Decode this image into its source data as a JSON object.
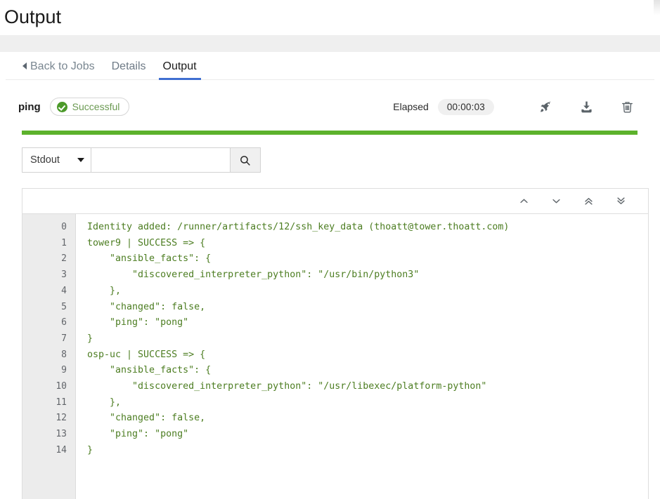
{
  "page": {
    "title": "Output"
  },
  "tabs": [
    {
      "label": "Back to Jobs",
      "name": "tab-back-to-jobs",
      "active": false
    },
    {
      "label": "Details",
      "name": "tab-details",
      "active": false
    },
    {
      "label": "Output",
      "name": "tab-output",
      "active": true
    }
  ],
  "job": {
    "name": "ping",
    "status_label": "Successful",
    "status_color": "#4c9a2a",
    "elapsed_label": "Elapsed",
    "elapsed_value": "00:00:03",
    "progress_color": "#5cb22c",
    "actions": [
      {
        "name": "relaunch-icon",
        "title": "Relaunch"
      },
      {
        "name": "download-icon",
        "title": "Download Output"
      },
      {
        "name": "delete-icon",
        "title": "Delete Job"
      }
    ]
  },
  "search": {
    "select_value": "Stdout",
    "input_value": "",
    "placeholder": "",
    "button_icon": "search-icon"
  },
  "output_nav": [
    {
      "name": "scroll-up-icon"
    },
    {
      "name": "scroll-down-icon"
    },
    {
      "name": "scroll-top-icon"
    },
    {
      "name": "scroll-bottom-icon"
    }
  ],
  "output": {
    "lines": [
      {
        "num": "0",
        "text": "Identity added: /runner/artifacts/12/ssh_key_data (thoatt@tower.thoatt.com)"
      },
      {
        "num": "1",
        "text": "tower9 | SUCCESS => {"
      },
      {
        "num": "2",
        "text": "    \"ansible_facts\": {"
      },
      {
        "num": "3",
        "text": "        \"discovered_interpreter_python\": \"/usr/bin/python3\""
      },
      {
        "num": "4",
        "text": "    },"
      },
      {
        "num": "5",
        "text": "    \"changed\": false,"
      },
      {
        "num": "6",
        "text": "    \"ping\": \"pong\""
      },
      {
        "num": "7",
        "text": "}"
      },
      {
        "num": "8",
        "text": "osp-uc | SUCCESS => {"
      },
      {
        "num": "9",
        "text": "    \"ansible_facts\": {"
      },
      {
        "num": "10",
        "text": "        \"discovered_interpreter_python\": \"/usr/libexec/platform-python\""
      },
      {
        "num": "11",
        "text": "    },"
      },
      {
        "num": "12",
        "text": "    \"changed\": false,"
      },
      {
        "num": "13",
        "text": "    \"ping\": \"pong\""
      },
      {
        "num": "14",
        "text": "}"
      }
    ]
  }
}
